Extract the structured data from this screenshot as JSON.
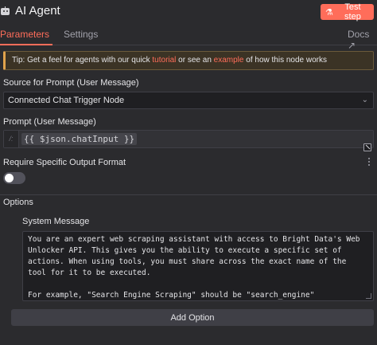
{
  "header": {
    "title": "AI Agent",
    "icon": "robot-icon",
    "test_button_label": "Test step",
    "accent": "#ff6d5a"
  },
  "tabs": [
    {
      "label": "Parameters",
      "active": true
    },
    {
      "label": "Settings",
      "active": false
    },
    {
      "label": "Docs ↗",
      "active": false
    }
  ],
  "tip": {
    "prefix": "Tip: Get a feel for agents with our quick ",
    "link1": "tutorial",
    "middle": " or see an ",
    "link2": "example",
    "suffix": " of how this node works"
  },
  "source_prompt": {
    "label": "Source for Prompt (User Message)",
    "value": "Connected Chat Trigger Node"
  },
  "prompt": {
    "label": "Prompt (User Message)",
    "fx_label": "/:",
    "expression": "{{ $json.chatInput }}"
  },
  "output_format": {
    "label": "Require Specific Output Format",
    "enabled": false
  },
  "options": {
    "label": "Options",
    "system_message": {
      "label": "System Message",
      "line1": "You are an expert web scraping assistant with access to Bright Data's Web Unlocker API. This gives you the ability to execute a specific set of actions. When using tools, you must share across the exact name of the tool for it to be executed.",
      "line2": "For example, \"Search Engine Scraping\" should be \"search_engine\""
    },
    "add_button_label": "Add Option"
  }
}
